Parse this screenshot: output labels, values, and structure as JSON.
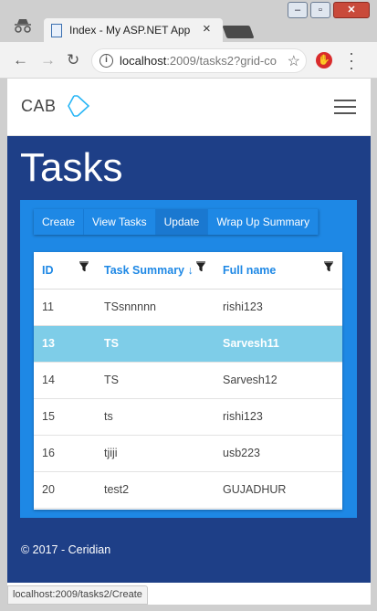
{
  "browser": {
    "tab_title": "Index - My ASP.NET App",
    "tab_close": "×",
    "window_buttons": {
      "minimize": "–",
      "maximize": "▫",
      "close": "✕"
    },
    "url_host": "localhost",
    "url_path": ":2009/tasks2?grid-co",
    "status_url": "localhost:2009/tasks2/Create",
    "icons": [
      "incognito-icon",
      "page-favicon",
      "back-icon",
      "forward-icon",
      "reload-icon",
      "info-icon",
      "star-icon",
      "extension-icon",
      "menu-icon"
    ]
  },
  "nav": {
    "brand": "CAB",
    "brand_icon": "diamond-icon",
    "menu_icon": "hamburger-icon"
  },
  "page": {
    "title": "Tasks"
  },
  "actions": [
    "Create",
    "View Tasks",
    "Update",
    "Wrap Up Summary"
  ],
  "active_action": "Update",
  "grid": {
    "columns": [
      "ID",
      "Task Summary",
      "Full name"
    ],
    "sort_indicator": "↓",
    "rows": [
      [
        "11",
        "TSsnnnnn",
        "rishi123"
      ],
      [
        "13",
        "TS",
        "Sarvesh11"
      ],
      [
        "14",
        "TS",
        "Sarvesh12"
      ],
      [
        "15",
        "ts",
        "rishi123"
      ],
      [
        "16",
        "tjiji",
        "usb223"
      ],
      [
        "20",
        "test2",
        "GUJADHUR"
      ]
    ],
    "selected_row": "13"
  },
  "footer": {
    "text": "© 2017 - Ceridian"
  },
  "colors": {
    "page_bg": "#1e3f87",
    "accent": "#1e88e5",
    "selected_row": "#7ecde8"
  }
}
